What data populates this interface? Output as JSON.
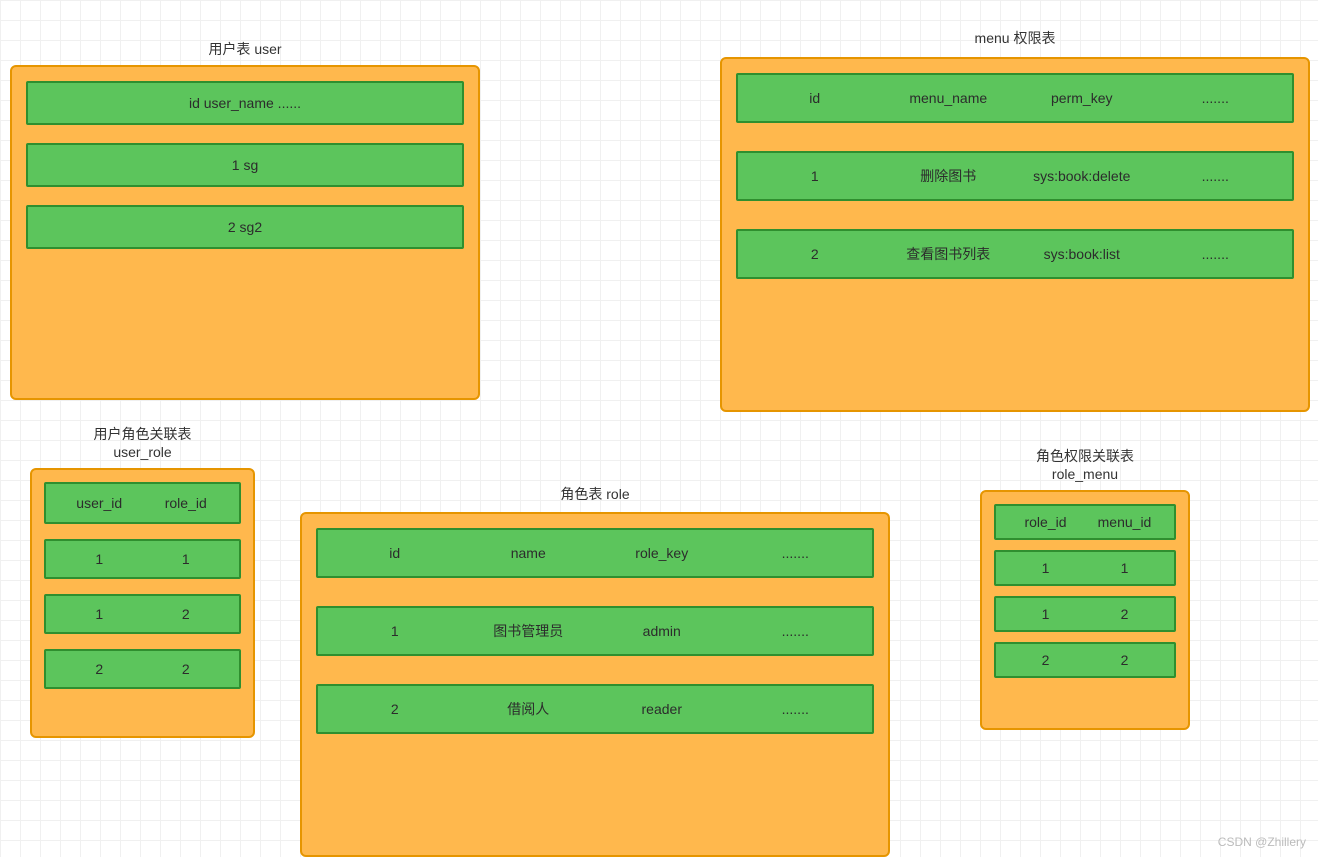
{
  "watermark": "CSDN @Zhillery",
  "tables": {
    "user": {
      "title": "用户表  user",
      "header": [
        "id user_name ......"
      ],
      "rows": [
        [
          "1     sg"
        ],
        [
          "2     sg2"
        ]
      ]
    },
    "menu": {
      "title": "menu 权限表",
      "header": [
        "id",
        "menu_name",
        "perm_key",
        "......."
      ],
      "rows": [
        [
          "1",
          "删除图书",
          "sys:book:delete",
          "......."
        ],
        [
          "2",
          "查看图书列表",
          "sys:book:list",
          "......."
        ]
      ]
    },
    "user_role": {
      "title": "用户角色关联表\nuser_role",
      "header": [
        "user_id",
        "role_id"
      ],
      "rows": [
        [
          "1",
          "1"
        ],
        [
          "1",
          "2"
        ],
        [
          "2",
          "2"
        ]
      ]
    },
    "role": {
      "title": "角色表   role",
      "header": [
        "id",
        "name",
        "role_key",
        "......."
      ],
      "rows": [
        [
          "1",
          "图书管理员",
          "admin",
          "......."
        ],
        [
          "2",
          "借阅人",
          "reader",
          "......."
        ]
      ]
    },
    "role_menu": {
      "title": "角色权限关联表\nrole_menu",
      "header": [
        "role_id",
        "menu_id"
      ],
      "rows": [
        [
          "1",
          "1"
        ],
        [
          "1",
          "2"
        ],
        [
          "2",
          "2"
        ]
      ]
    }
  }
}
